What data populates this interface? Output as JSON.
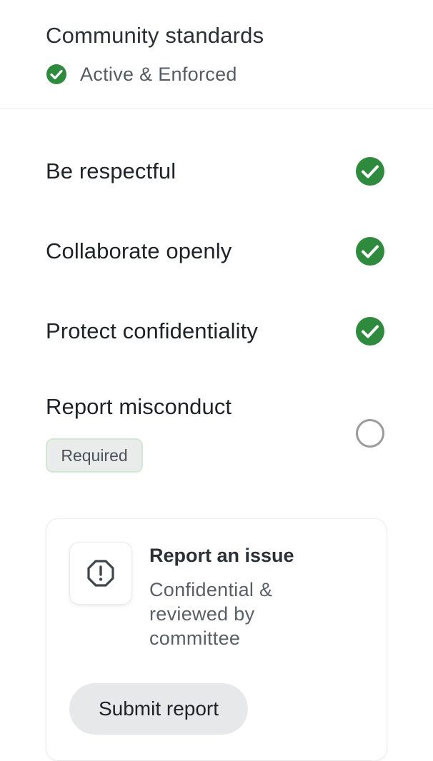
{
  "header": {
    "title": "Community standards",
    "status": "Active & Enforced"
  },
  "rules": [
    {
      "label": "Be respectful",
      "checked": true
    },
    {
      "label": "Collaborate openly",
      "checked": true
    },
    {
      "label": "Protect confidentiality",
      "checked": true
    },
    {
      "label": "Report misconduct",
      "checked": false,
      "badge": "Required"
    }
  ],
  "report_card": {
    "title": "Report an issue",
    "description": "Confidential & reviewed by committee",
    "button_label": "Submit report",
    "icon": "alert-octagon-icon"
  },
  "colors": {
    "check_green": "#2e8b3d",
    "badge_bg": "#e9ecea",
    "badge_border": "#d3e8d3",
    "button_bg": "#e7e8e9"
  }
}
